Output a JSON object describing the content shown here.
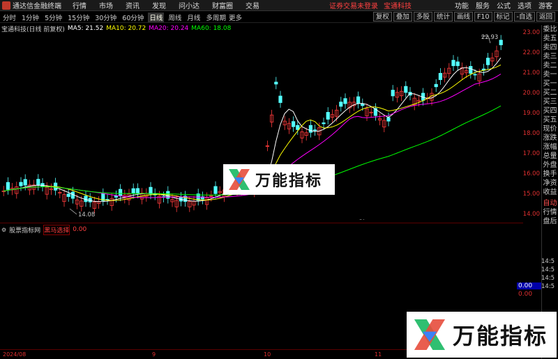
{
  "menubar": {
    "app_title": "通达信金融终端",
    "items": [
      "行情",
      "市场",
      "资讯",
      "发现",
      "问小达",
      "财富圈",
      "交易"
    ],
    "notice": "证券交易未登录",
    "company": "宝通科技",
    "right_items": [
      "功能",
      "服务",
      "公式",
      "选项",
      "游客"
    ]
  },
  "periods": {
    "items": [
      "分时",
      "1分钟",
      "5分钟",
      "15分钟",
      "30分钟",
      "60分钟",
      "日线",
      "周线",
      "月线",
      "多周期"
    ],
    "active_index": 6,
    "more": "更多"
  },
  "toolbar": {
    "buttons": [
      "复权",
      "叠加",
      "多股",
      "统计",
      "画线",
      "F10",
      "标记",
      "-自选",
      "返回"
    ]
  },
  "info": {
    "stock": "宝通科技(日线 前复权)",
    "ma5": "MA5: 21.52",
    "ma10": "MA10: 20.72",
    "ma20": "MA20: 20.24",
    "ma60": "MA60: 18.08",
    "colors": {
      "ma5": "#ffffff",
      "ma10": "#ffff00",
      "ma20": "#ff00ff",
      "ma60": "#00ff00"
    }
  },
  "price_axis": [
    "23.00",
    "22.00",
    "21.00",
    "20.00",
    "19.00",
    "18.00",
    "17.00",
    "16.00",
    "15.00",
    "14.00"
  ],
  "annotations": {
    "high": "22.93",
    "low": "14.08",
    "cai": "财"
  },
  "subchart": {
    "name": "股票指标网",
    "indicator": "黑马选择",
    "value": "0.00",
    "axis_values": [
      "0.00",
      "0.00"
    ]
  },
  "xaxis": {
    "labels": [
      "2024/08",
      "9",
      "10",
      "11"
    ]
  },
  "side_panel": {
    "labels": [
      "委比",
      "卖五",
      "卖四",
      "卖三",
      "卖二",
      "卖一",
      "买一",
      "买二",
      "买三",
      "买四",
      "买五",
      "现价",
      "涨跌",
      "涨幅",
      "总量",
      "外盘",
      "换手",
      "净资",
      "收益"
    ],
    "bottom_labels": [
      "自动",
      "行情",
      "盘后"
    ],
    "times": [
      "14:5",
      "14:5",
      "14:5",
      "14:5"
    ]
  },
  "watermark": {
    "text": "万能指标"
  }
}
